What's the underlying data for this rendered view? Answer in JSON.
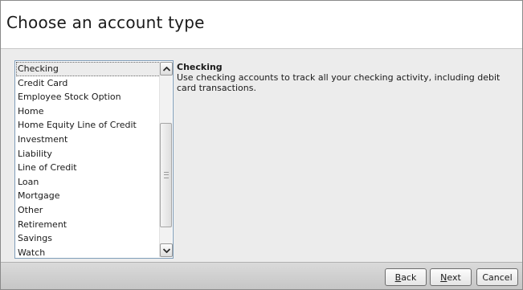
{
  "header": {
    "title": "Choose an account type"
  },
  "account_list": {
    "items": [
      {
        "label": "Checking",
        "selected": true
      },
      {
        "label": "Credit Card"
      },
      {
        "label": "Employee Stock Option"
      },
      {
        "label": "Home"
      },
      {
        "label": "Home Equity Line of Credit"
      },
      {
        "label": "Investment"
      },
      {
        "label": "Liability"
      },
      {
        "label": "Line of Credit"
      },
      {
        "label": "Loan"
      },
      {
        "label": "Mortgage"
      },
      {
        "label": "Other"
      },
      {
        "label": "Retirement"
      },
      {
        "label": "Savings"
      },
      {
        "label": "Watch"
      }
    ]
  },
  "description": {
    "title": "Checking",
    "text": "Use checking accounts to track all your checking activity, including debit card transactions."
  },
  "footer": {
    "back": {
      "mnemonic": "B",
      "rest": "ack"
    },
    "next": {
      "mnemonic": "N",
      "rest": "ext"
    },
    "cancel": {
      "label": "Cancel"
    }
  },
  "icons": {
    "scroll_up": "chevron-up-icon",
    "scroll_down": "chevron-down-icon"
  },
  "colors": {
    "list_border": "#7f9db9",
    "background": "#ececec",
    "footer": "#d0d0d0"
  }
}
